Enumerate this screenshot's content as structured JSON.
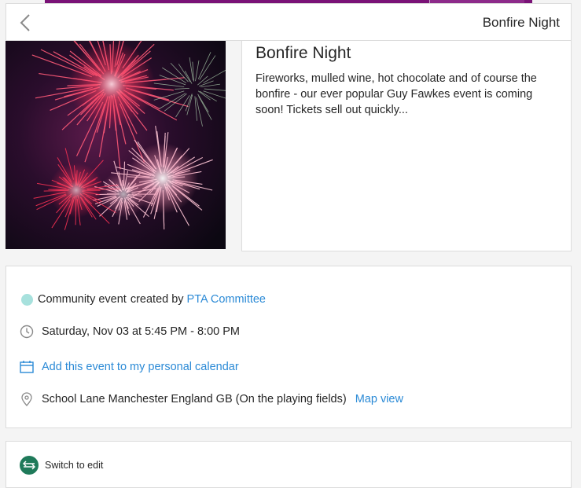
{
  "header": {
    "title": "Bonfire Night",
    "back_icon": "chevron-left-icon"
  },
  "event": {
    "title": "Bonfire Night",
    "description": "Fireworks, mulled wine, hot chocolate and of course the bonfire - our ever popular Guy Fawkes event is coming soon! Tickets sell out quickly...",
    "image": "fireworks-photo"
  },
  "details": {
    "category_color": "#a7e1dd",
    "category": "Community event",
    "created_by_label": "created by",
    "creator": "PTA Committee",
    "datetime": "Saturday, Nov 03 at 5:45 PM - 8:00 PM",
    "calendar_link": "Add this event to my personal calendar",
    "location": "School Lane Manchester England GB (On the playing fields)",
    "map_link": "Map view"
  },
  "footer": {
    "switch_label": "Switch to edit",
    "switch_icon": "swap-arrows-icon"
  },
  "colors": {
    "accent": "#2b8ad6",
    "brand_bar": "#7a1277",
    "switch_button": "#1f7a5a"
  }
}
